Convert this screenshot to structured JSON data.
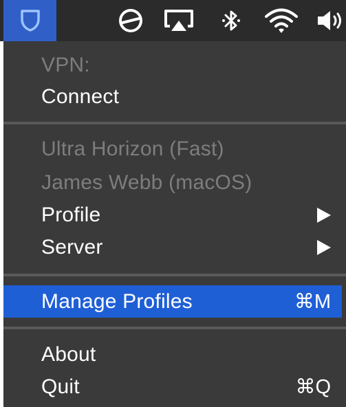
{
  "menubar": {
    "icons": [
      {
        "name": "vpn-shield-icon",
        "active": true
      },
      {
        "name": "sync-status-icon"
      },
      {
        "name": "airplay-icon"
      },
      {
        "name": "bluetooth-icon"
      },
      {
        "name": "wifi-icon"
      },
      {
        "name": "volume-icon"
      }
    ],
    "active_color": "#2f5fc7"
  },
  "menu": {
    "vpn_header": "VPN:",
    "connect": "Connect",
    "server_favorites": [
      "Ultra Horizon (Fast)",
      "James Webb (macOS)"
    ],
    "profile": "Profile",
    "server": "Server",
    "manage_profiles": "Manage Profiles",
    "manage_profiles_shortcut": "⌘M",
    "about": "About",
    "quit": "Quit",
    "quit_shortcut": "⌘Q",
    "highlight_color": "#1f5fd6"
  }
}
